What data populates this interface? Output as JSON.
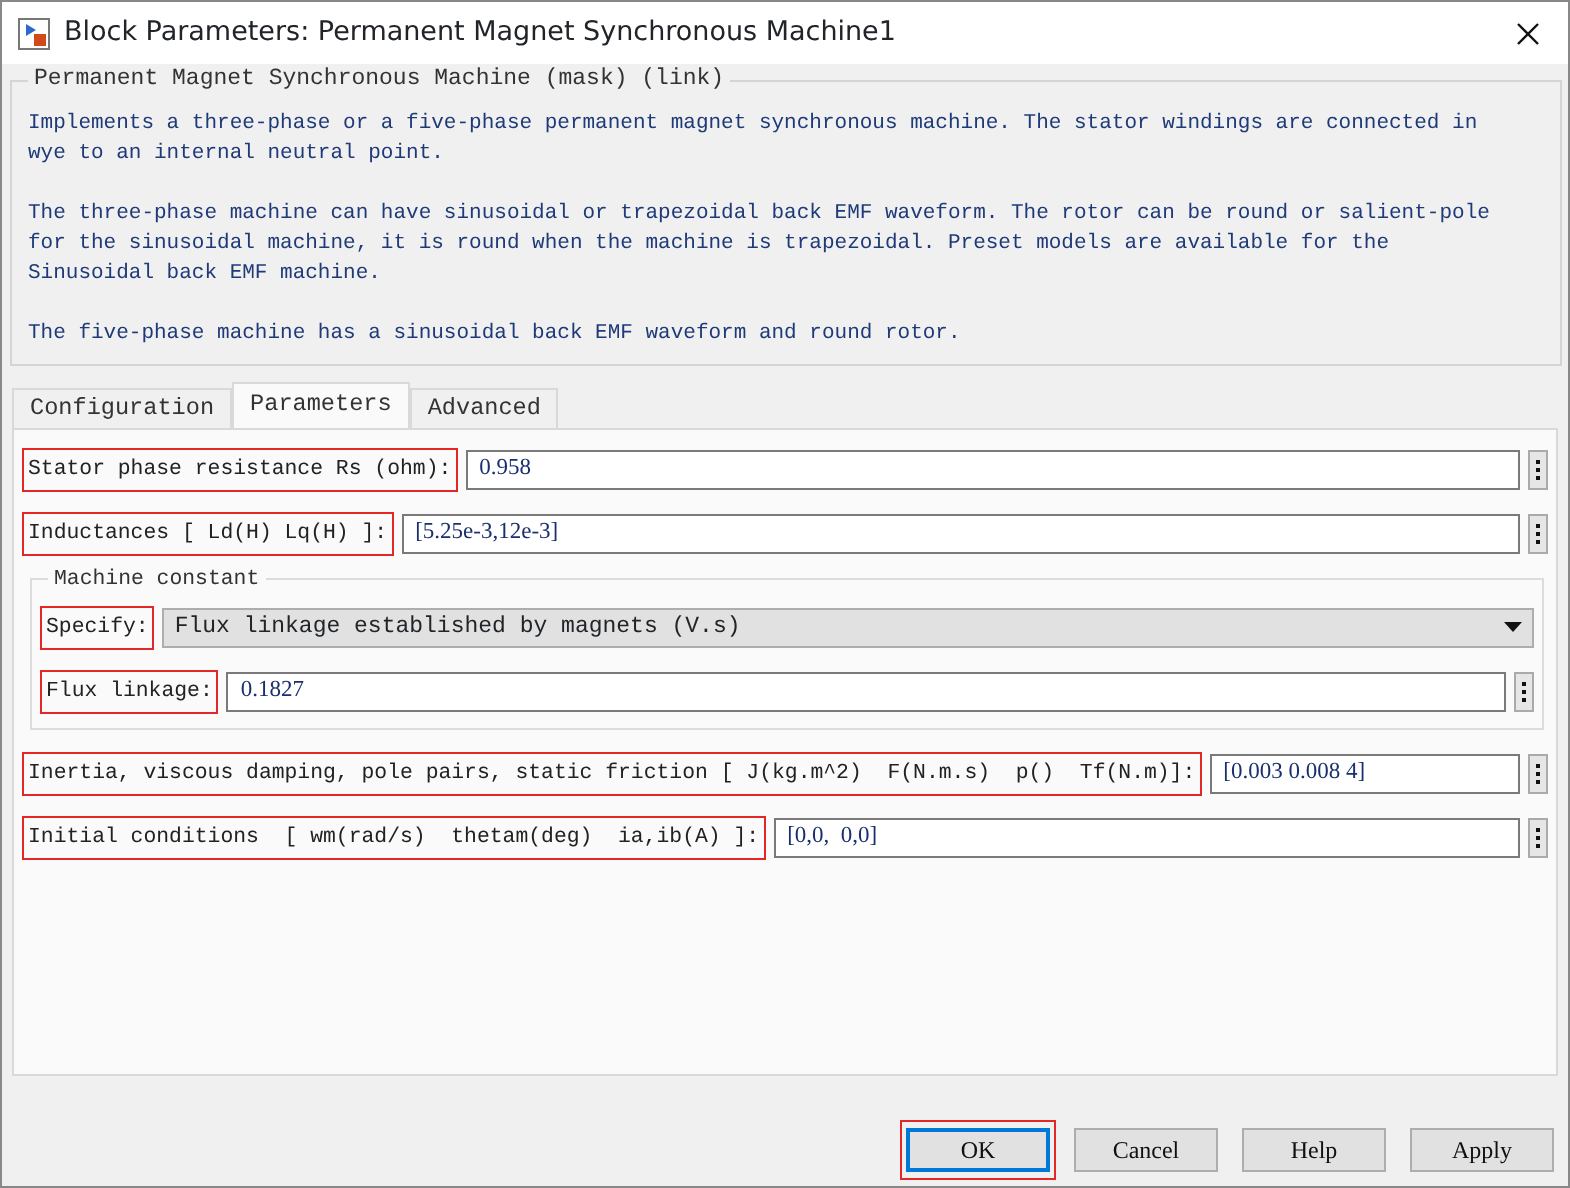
{
  "window": {
    "title": "Block Parameters: Permanent Magnet Synchronous Machine1"
  },
  "description": {
    "title": "Permanent Magnet Synchronous Machine (mask) (link)",
    "paragraphs": [
      {
        "lines": [
          "Implements a three-phase or a five-phase permanent magnet synchronous machine. The stator windings are connected in",
          "wye to an internal neutral point."
        ]
      },
      {
        "lines": [
          "The three-phase machine can have sinusoidal or trapezoidal back EMF waveform. The rotor can be round or salient-pole",
          "for the sinusoidal machine, it is round when the machine is trapezoidal. Preset models are available for the",
          "Sinusoidal back EMF machine."
        ]
      },
      {
        "lines": [
          "The five-phase machine has a sinusoidal back EMF waveform and round rotor."
        ]
      }
    ]
  },
  "tabs": [
    {
      "label": "Configuration",
      "selected": false
    },
    {
      "label": "Parameters",
      "selected": true
    },
    {
      "label": "Advanced",
      "selected": false
    }
  ],
  "parameters": [
    {
      "kind": "field",
      "label": "Stator phase resistance Rs (ohm):",
      "value": "0.958",
      "highlighted": true
    },
    {
      "kind": "field",
      "label": "Inductances [ Ld(H) Lq(H) ]:",
      "value": "[5.25e-3,12e-3]",
      "highlighted": true
    },
    {
      "kind": "group",
      "title": "Machine constant",
      "children": [
        {
          "kind": "dropdown",
          "label": "Specify:",
          "value": "Flux linkage established by magnets (V.s)",
          "highlighted": true
        },
        {
          "kind": "field",
          "label": "Flux linkage:",
          "value": "0.1827",
          "highlighted": true
        }
      ]
    },
    {
      "kind": "field",
      "label": "Inertia, viscous damping, pole pairs, static friction [ J(kg.m^2)  F(N.m.s)  p()  Tf(N.m)]:",
      "value": "[0.003 0.008 4]",
      "highlighted": true
    },
    {
      "kind": "field",
      "label": "Initial conditions  [ wm(rad/s)  thetam(deg)  ia,ib(A) ]:",
      "value": "[0,0,  0,0]",
      "highlighted": true
    }
  ],
  "buttons": [
    {
      "label": "OK",
      "default": true,
      "highlighted": true
    },
    {
      "label": "Cancel",
      "default": false,
      "highlighted": false
    },
    {
      "label": "Help",
      "default": false,
      "highlighted": false
    },
    {
      "label": "Apply",
      "default": false,
      "highlighted": false
    }
  ]
}
